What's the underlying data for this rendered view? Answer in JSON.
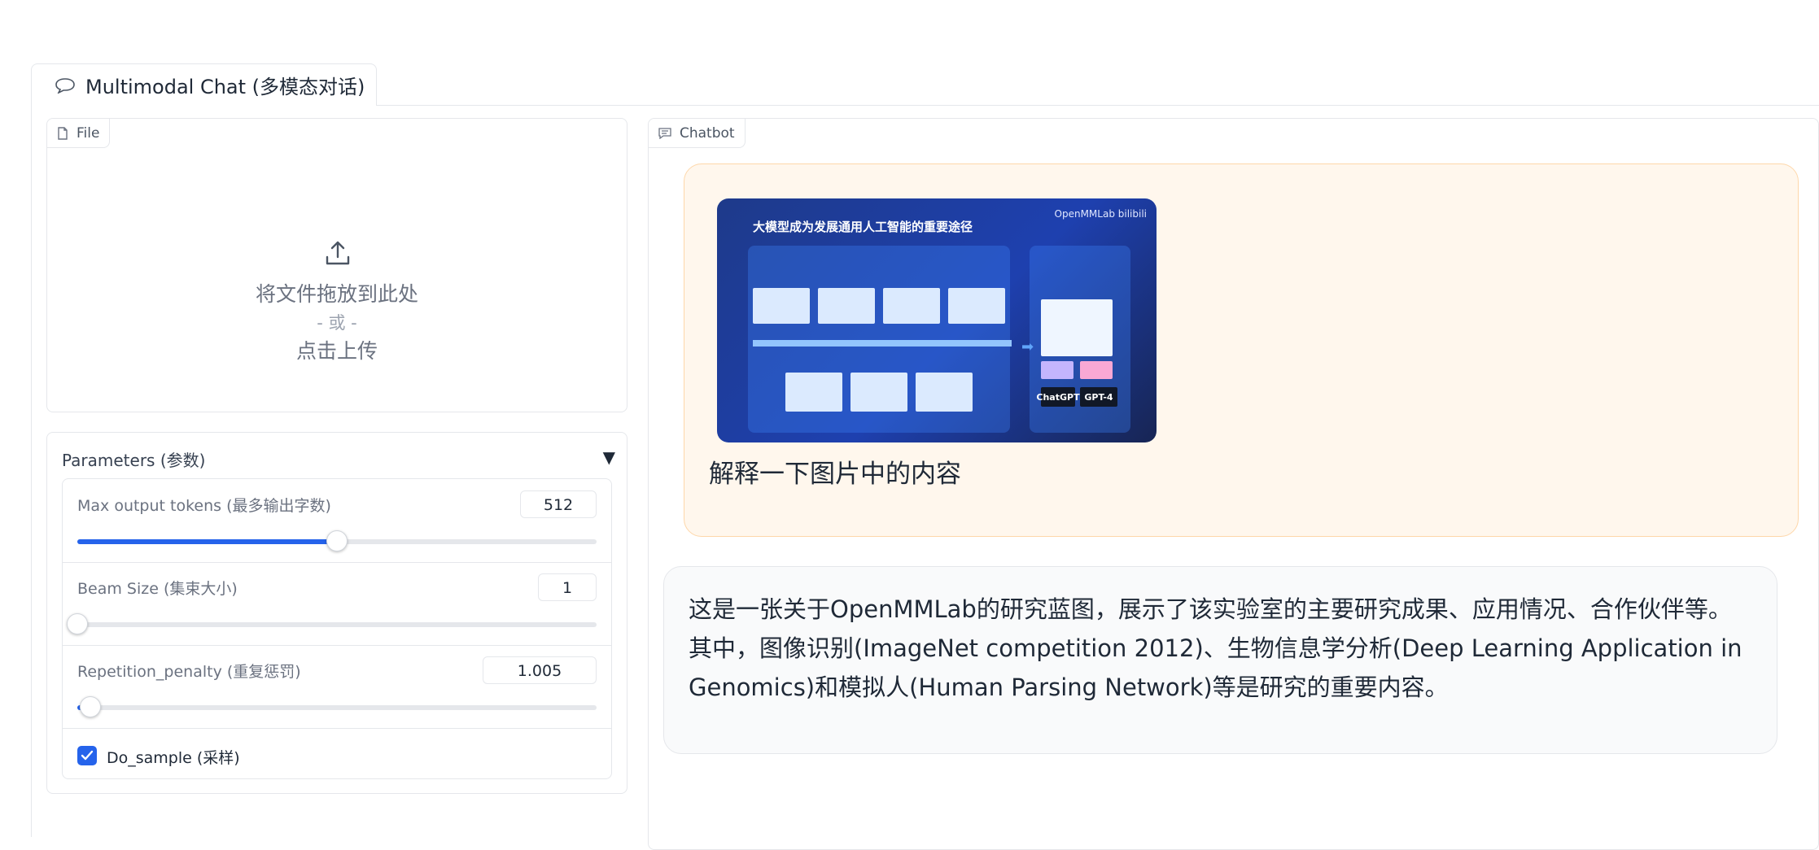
{
  "tabs": [
    {
      "label": "Multimodal Chat (多模态对话)",
      "icon": "chat-bubble-icon",
      "active": true
    }
  ],
  "file_upload": {
    "label": "File",
    "icon": "file-icon",
    "drop_text": "将文件拖放到此处",
    "or_text": "- 或 -",
    "click_text": "点击上传"
  },
  "parameters": {
    "title": "Parameters (参数)",
    "toggle": "▼",
    "max_tokens": {
      "label": "Max output tokens (最多输出字数)",
      "value": "512",
      "fraction": 0.5
    },
    "beam_size": {
      "label": "Beam Size (集束大小)",
      "value": "1",
      "fraction": 0.0
    },
    "repetition_penalty": {
      "label": "Repetition_penalty (重复惩罚)",
      "value": "1.005",
      "fraction": 0.025
    },
    "do_sample": {
      "label": "Do_sample (采样)",
      "checked": true
    }
  },
  "chatbot": {
    "label": "Chatbot",
    "icon": "chat-icon",
    "user_message": {
      "image": {
        "title": "大模型成为发展通用人工智能的重要途径",
        "logo": "OpenMMLab bilibili",
        "chips": [
          "ChatGPT",
          "GPT-4"
        ]
      },
      "text": "解释一下图片中的内容"
    },
    "bot_message": {
      "text": "这是一张关于OpenMMLab的研究蓝图，展示了该实验室的主要研究成果、应用情况、合作伙伴等。其中，图像识别(ImageNet competition 2012)、生物信息学分析(Deep Learning Application in Genomics)和模拟人(Human Parsing Network)等是研究的重要内容。"
    }
  },
  "colors": {
    "accent": "#2563eb",
    "user_bubble": "#fff7ed",
    "bot_bubble": "#f9fafb",
    "border": "#e5e7eb"
  }
}
